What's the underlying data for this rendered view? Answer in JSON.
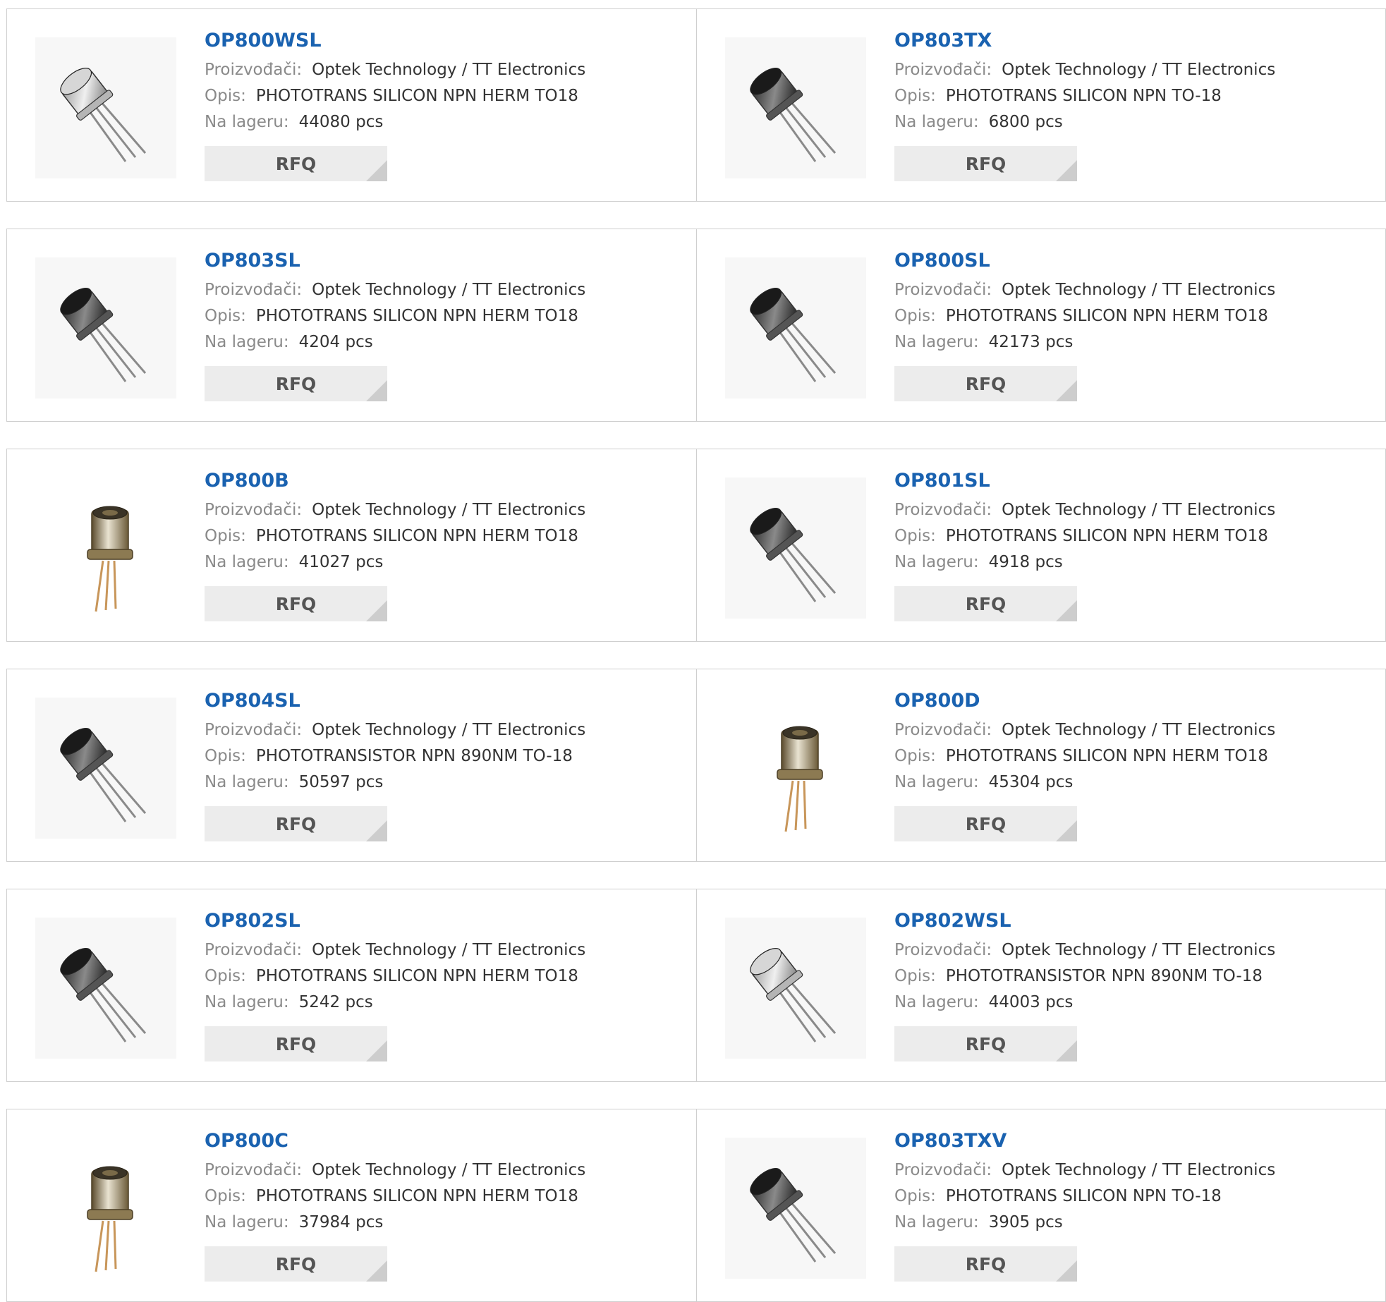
{
  "labels": {
    "manufacturer": "Proizvođači:",
    "description": "Opis:",
    "stock": "Na lageru:",
    "rfq": "RFQ"
  },
  "products": [
    {
      "part": "OP800WSL",
      "manufacturer": "Optek Technology / TT Electronics",
      "description": "PHOTOTRANS SILICON NPN HERM TO18",
      "stock": "44080 pcs",
      "image": "silver-can-phototransistor"
    },
    {
      "part": "OP803TX",
      "manufacturer": "Optek Technology / TT Electronics",
      "description": "PHOTOTRANS SILICON NPN TO-18",
      "stock": "6800 pcs",
      "image": "dark-lens-phototransistor"
    },
    {
      "part": "OP803SL",
      "manufacturer": "Optek Technology / TT Electronics",
      "description": "PHOTOTRANS SILICON NPN HERM TO18",
      "stock": "4204 pcs",
      "image": "dark-lens-phototransistor"
    },
    {
      "part": "OP800SL",
      "manufacturer": "Optek Technology / TT Electronics",
      "description": "PHOTOTRANS SILICON NPN HERM TO18",
      "stock": "42173 pcs",
      "image": "dark-lens-phototransistor"
    },
    {
      "part": "OP800B",
      "manufacturer": "Optek Technology / TT Electronics",
      "description": "PHOTOTRANS SILICON NPN HERM TO18",
      "stock": "41027 pcs",
      "image": "gold-lead-phototransistor"
    },
    {
      "part": "OP801SL",
      "manufacturer": "Optek Technology / TT Electronics",
      "description": "PHOTOTRANS SILICON NPN HERM TO18",
      "stock": "4918 pcs",
      "image": "dark-lens-phototransistor"
    },
    {
      "part": "OP804SL",
      "manufacturer": "Optek Technology / TT Electronics",
      "description": "PHOTOTRANSISTOR NPN 890NM TO-18",
      "stock": "50597 pcs",
      "image": "dark-lens-phototransistor"
    },
    {
      "part": "OP800D",
      "manufacturer": "Optek Technology / TT Electronics",
      "description": "PHOTOTRANS SILICON NPN HERM TO18",
      "stock": "45304 pcs",
      "image": "gold-lead-phototransistor"
    },
    {
      "part": "OP802SL",
      "manufacturer": "Optek Technology / TT Electronics",
      "description": "PHOTOTRANS SILICON NPN HERM TO18",
      "stock": "5242 pcs",
      "image": "dark-lens-phototransistor"
    },
    {
      "part": "OP802WSL",
      "manufacturer": "Optek Technology / TT Electronics",
      "description": "PHOTOTRANSISTOR NPN 890NM TO-18",
      "stock": "44003 pcs",
      "image": "silver-can-phototransistor"
    },
    {
      "part": "OP800C",
      "manufacturer": "Optek Technology / TT Electronics",
      "description": "PHOTOTRANS SILICON NPN HERM TO18",
      "stock": "37984 pcs",
      "image": "gold-lead-phototransistor"
    },
    {
      "part": "OP803TXV",
      "manufacturer": "Optek Technology / TT Electronics",
      "description": "PHOTOTRANS SILICON NPN TO-18",
      "stock": "3905 pcs",
      "image": "dark-lens-phototransistor"
    }
  ],
  "colors": {
    "part_link": "#1a62b0",
    "label": "#8a8a8a",
    "value": "#333333",
    "rfq_bg": "#ececec",
    "border": "#cfcfcf"
  }
}
